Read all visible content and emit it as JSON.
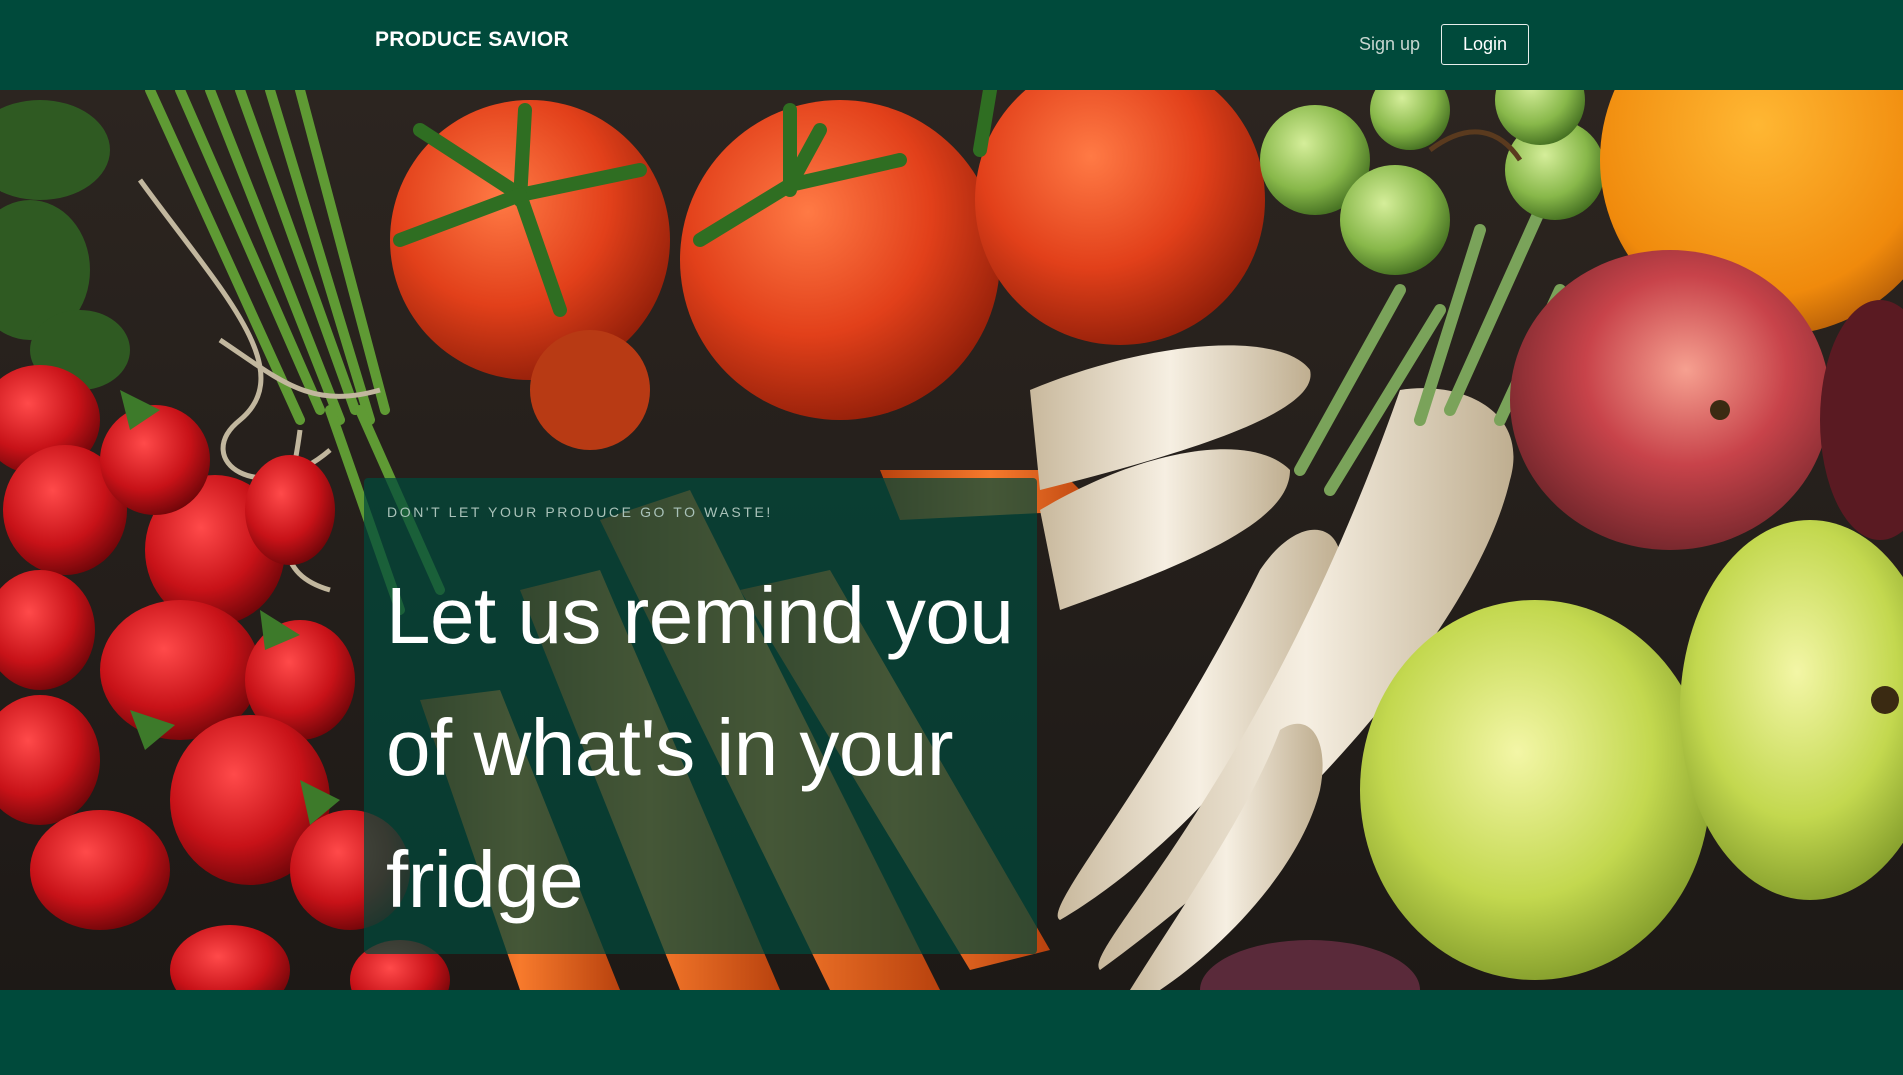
{
  "nav": {
    "brand": "PRODUCE SAVIOR",
    "signup_label": "Sign up",
    "login_label": "Login"
  },
  "hero": {
    "tagline": "DON'T LET YOUR PRODUCE GO TO WASTE!",
    "headline": "Let us remind you of what's in your fridge"
  },
  "colors": {
    "brand_green": "#004a3b",
    "panel_overlay": "rgba(0,74,59,0.72)",
    "text_white": "#ffffff",
    "tagline_text": "#a9c2b9"
  }
}
